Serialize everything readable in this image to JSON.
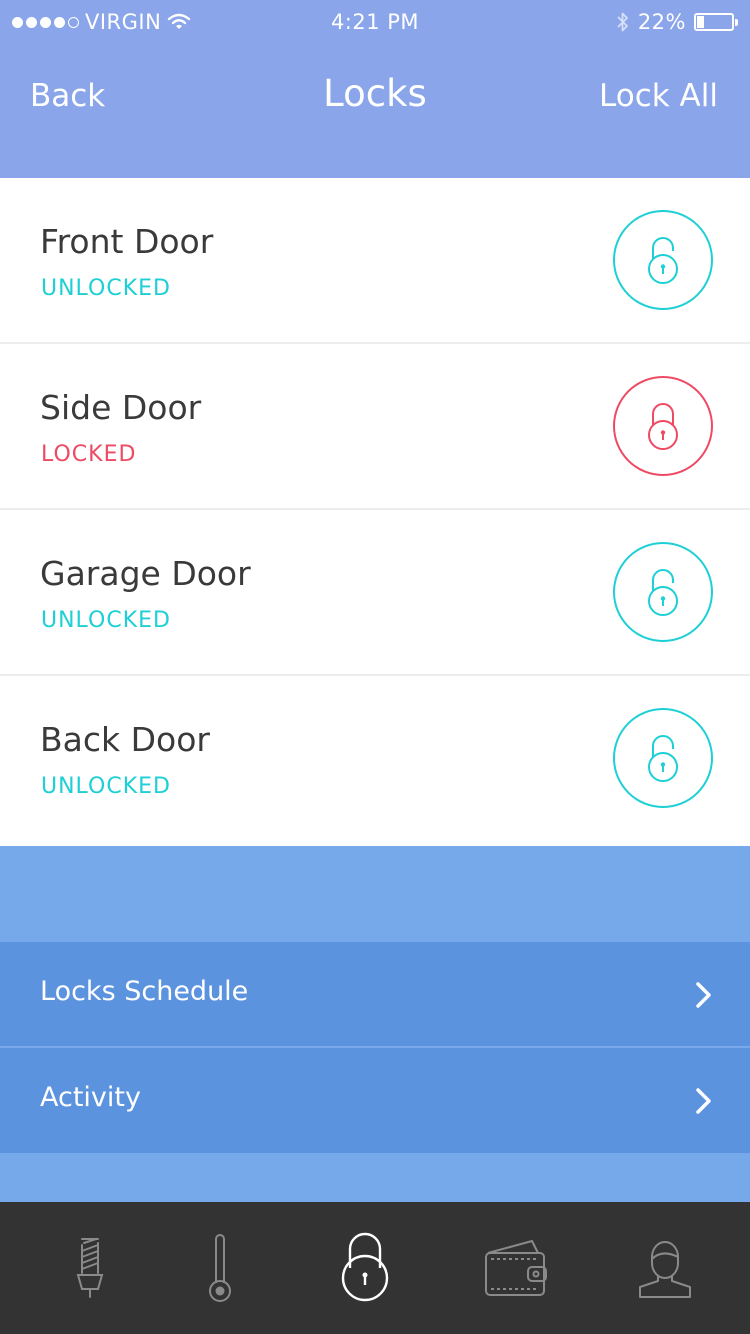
{
  "status_bar": {
    "carrier": "VIRGIN",
    "time": "4:21 PM",
    "battery_percent_text": "22%",
    "battery_level": 0.22
  },
  "nav": {
    "back_label": "Back",
    "title": "Locks",
    "lock_all_label": "Lock All"
  },
  "locks": [
    {
      "name": "Front Door",
      "status": "UNLOCKED",
      "color": "#1ed0d6"
    },
    {
      "name": "Side Door",
      "status": "LOCKED",
      "color": "#ee4a64"
    },
    {
      "name": "Garage Door",
      "status": "UNLOCKED",
      "color": "#1ed0d6"
    },
    {
      "name": "Back Door",
      "status": "UNLOCKED",
      "color": "#1ed0d6"
    }
  ],
  "menu": [
    {
      "label": "Locks Schedule",
      "icon": "chevron-right-icon"
    },
    {
      "label": "Activity",
      "icon": "chevron-right-icon"
    }
  ],
  "tabs": [
    {
      "icon": "lightbulb-icon",
      "active": false
    },
    {
      "icon": "thermometer-icon",
      "active": false
    },
    {
      "icon": "padlock-icon",
      "active": true
    },
    {
      "icon": "wallet-icon",
      "active": false
    },
    {
      "icon": "user-icon",
      "active": false
    }
  ],
  "colors": {
    "header": "#8aa5ea",
    "unlocked": "#1ed0d6",
    "locked": "#ee4a64",
    "menu": "#5c93df",
    "blue_area": "#76a9ea",
    "tab_bar": "#333333"
  }
}
